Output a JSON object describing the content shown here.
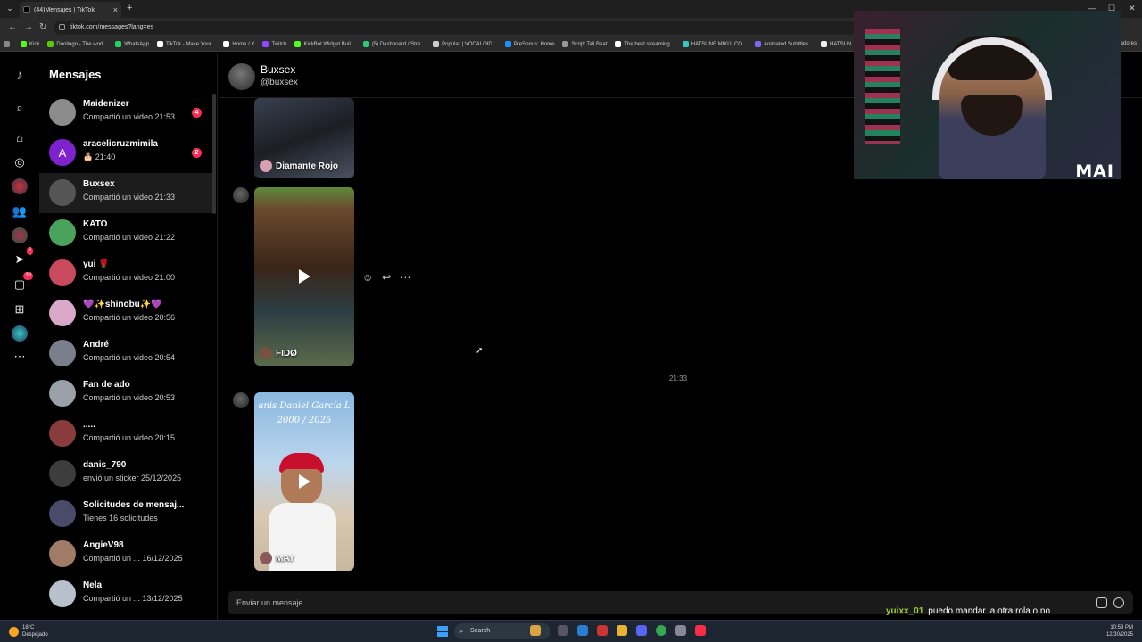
{
  "browser": {
    "tab_title": "(44)Mensajes | TikTok",
    "url": "tiktok.com/messages?lang=es",
    "bookmarks": [
      {
        "label": "Kick",
        "color": "#53fc18"
      },
      {
        "label": "Duolingo - The worl...",
        "color": "#58cc02"
      },
      {
        "label": "WhatsApp",
        "color": "#25d366"
      },
      {
        "label": "TikTok - Make Your...",
        "color": "#ffffff"
      },
      {
        "label": "Home / X",
        "color": "#ffffff"
      },
      {
        "label": "Twitch",
        "color": "#9146ff"
      },
      {
        "label": "KickBot Widget Buil...",
        "color": "#53fc18"
      },
      {
        "label": "(5) Dashboard / Stre...",
        "color": "#2ecc71"
      },
      {
        "label": "Popular | VOCALOID...",
        "color": "#cccccc"
      },
      {
        "label": "PreSonus: Home",
        "color": "#1e90ff"
      },
      {
        "label": "Script Tail Beat",
        "color": "#999999"
      },
      {
        "label": "The best streaming...",
        "color": "#ffffff"
      },
      {
        "label": "HATSUNE MIKU: CO...",
        "color": "#39c5bb"
      },
      {
        "label": "Animated Subtitles...",
        "color": "#7b68ee"
      },
      {
        "label": "HATSUN",
        "color": "#eeeeee"
      }
    ],
    "bookmarks_tail": "adores"
  },
  "rail": {
    "upload_badge": "6",
    "inbox_badge": "38"
  },
  "conversations": {
    "title": "Mensajes",
    "items": [
      {
        "name": "Maidenizer",
        "sub": "Compartió un video 21:53",
        "badge": "4",
        "avatar": "#8c8c8c"
      },
      {
        "name": "aracelicruzmimila",
        "sub": "🎂 21:40",
        "badge": "2",
        "avatar": "#7e22ce",
        "initial": "A"
      },
      {
        "name": "Buxsex",
        "sub": "Compartió un video 21:33",
        "badge": "",
        "avatar": "#555555"
      },
      {
        "name": "KATO",
        "sub": "Compartió un video 21:22",
        "badge": "",
        "avatar": "#4aa35a"
      },
      {
        "name": "yui 🌹",
        "sub": "Compartió un video 21:00",
        "badge": "",
        "avatar": "#c94a5c"
      },
      {
        "name": "💜✨shinobu✨💜",
        "sub": "Compartió un video 20:56",
        "badge": "",
        "avatar": "#d9a7c7"
      },
      {
        "name": "André",
        "sub": "Compartió un video 20:54",
        "badge": "",
        "avatar": "#7a7f8c"
      },
      {
        "name": "Fan de ado",
        "sub": "Compartió un video 20:53",
        "badge": "",
        "avatar": "#9aa0a8"
      },
      {
        "name": ".....",
        "sub": "Compartió un video 20:15",
        "badge": "",
        "avatar": "#8a3c3c"
      },
      {
        "name": "danis_790",
        "sub": "envió un sticker 25/12/2025",
        "badge": "",
        "avatar": "#3d3d3d"
      },
      {
        "name": "Solicitudes de mensaj...",
        "sub": "Tienes 16 solicitudes",
        "badge": "",
        "avatar": "#4a4a6a"
      },
      {
        "name": "AngieV98",
        "sub": "Compartió un ...  16/12/2025",
        "badge": "",
        "avatar": "#a07c68"
      },
      {
        "name": "Nela",
        "sub": "Compartió un ...  13/12/2025",
        "badge": "",
        "avatar": "#b8c0cc"
      }
    ]
  },
  "chat": {
    "name": "Buxsex",
    "handle": "@buxsex",
    "videos": [
      {
        "caption": "Diamante Rojo"
      },
      {
        "caption": "FIDØ"
      },
      {
        "caption": "MAY",
        "overlay_top": "anis Daniel García L",
        "overlay_years": "2000 / 2025"
      }
    ],
    "time_separator": "21:33",
    "placeholder": "Enviar un mensaje..."
  },
  "stream": {
    "cam_logo": "MAI",
    "chat_user": "yuixx_01",
    "chat_msg": "puedo mandar la otra rola o no"
  },
  "taskbar": {
    "temp": "18°C",
    "weather": "Despejado",
    "search": "Search",
    "time": "10:53 PM",
    "date": "12/30/2025"
  }
}
